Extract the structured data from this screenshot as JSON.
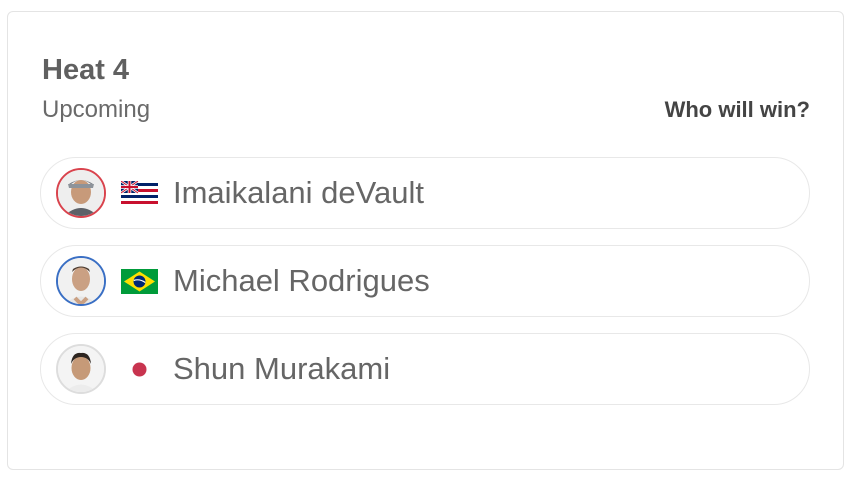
{
  "heat": {
    "title": "Heat 4",
    "status": "Upcoming",
    "prompt": "Who will win?"
  },
  "surfers": [
    {
      "name": "Imaikalani deVault",
      "flag_icon": "hawaii-flag-icon",
      "ring_color": "#d9434d"
    },
    {
      "name": "Michael Rodrigues",
      "flag_icon": "brazil-flag-icon",
      "ring_color": "#3a6fc4"
    },
    {
      "name": "Shun Murakami",
      "flag_icon": "japan-flag-icon",
      "ring_color": "#dddddd"
    }
  ]
}
